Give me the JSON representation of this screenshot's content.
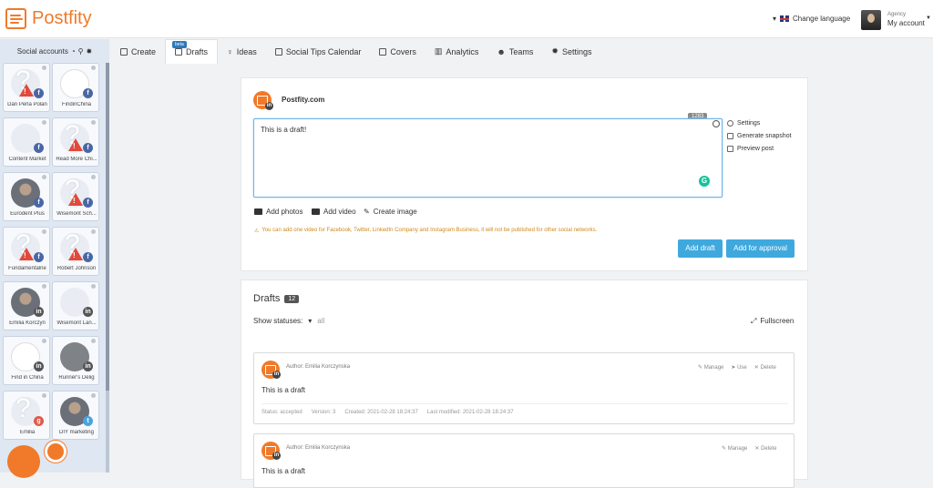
{
  "app": {
    "brand": "Postfity",
    "brand_color": "#f07a2a"
  },
  "topbar": {
    "change_language": "Change language",
    "account_role": "Agency",
    "account_label": "My account"
  },
  "sidebar": {
    "title": "Social accounts",
    "accounts": [
      {
        "name": "Dan Perla Polan",
        "network": "fb",
        "avatar": "placeholder-warning"
      },
      {
        "name": "FindinChina",
        "network": "fb",
        "avatar": "panda"
      },
      {
        "name": "Content Market",
        "network": "fb",
        "avatar": "wisemont"
      },
      {
        "name": "Read More Chi...",
        "network": "fb",
        "avatar": "placeholder-warning"
      },
      {
        "name": "Eurodent Plus",
        "network": "fb",
        "avatar": "photo"
      },
      {
        "name": "Wisemont Sch...",
        "network": "fb",
        "avatar": "placeholder-warning"
      },
      {
        "name": "Fundamentalne",
        "network": "fb",
        "avatar": "placeholder-warning"
      },
      {
        "name": "Robert Johnson",
        "network": "fb",
        "avatar": "placeholder-warning"
      },
      {
        "name": "Emilia Korczyn",
        "network": "li",
        "avatar": "photo"
      },
      {
        "name": "Wisemont Lan...",
        "network": "li",
        "avatar": "wisemont"
      },
      {
        "name": "Find in China",
        "network": "li",
        "avatar": "panda"
      },
      {
        "name": "Runner's Delig",
        "network": "li",
        "avatar": "runner"
      },
      {
        "name": "Emilia",
        "network": "gp",
        "avatar": "placeholder"
      },
      {
        "name": "DIY marketing",
        "network": "tw",
        "avatar": "photo"
      }
    ]
  },
  "tabs": [
    {
      "label": "Create",
      "icon": "edit-icon",
      "badge": ""
    },
    {
      "label": "Drafts",
      "icon": "drafts-icon",
      "badge": "beta"
    },
    {
      "label": "Ideas",
      "icon": "lightbulb-icon",
      "badge": ""
    },
    {
      "label": "Social Tips Calendar",
      "icon": "calendar-icon",
      "badge": ""
    },
    {
      "label": "Covers",
      "icon": "image-icon",
      "badge": ""
    },
    {
      "label": "Analytics",
      "icon": "bar-chart-icon",
      "badge": ""
    },
    {
      "label": "Teams",
      "icon": "users-icon",
      "badge": ""
    },
    {
      "label": "Settings",
      "icon": "gears-icon",
      "badge": ""
    }
  ],
  "composer": {
    "account_name": "Postfity.com",
    "text": "This is a draft!",
    "char_count": "1283",
    "settings": "Settings",
    "snapshot": "Generate snapshot",
    "preview": "Preview post",
    "add_photos": "Add photos",
    "add_video": "Add video",
    "create_image": "Create image",
    "notice": "You can add one video for Facebook, Twitter, LinkedIn Company and Instagram Business, it will not be published for other social networks.",
    "add_draft": "Add draft",
    "add_approval": "Add for approval"
  },
  "drafts": {
    "title": "Drafts",
    "count": "12",
    "show_statuses": "Show statuses:",
    "status_filter": "all",
    "fullscreen": "Fullscreen",
    "items": [
      {
        "author": "Author: Emilia Korczynska",
        "body": "This is a draft",
        "manage": "Manage",
        "use": "Use",
        "delete": "Delete",
        "status": "Status: accepted",
        "version": "Version: 3",
        "created": "Created: 2021-02-28 18:24:37",
        "modified": "Last modified: 2021-02-28 18:24:37"
      },
      {
        "author": "Author: Emilia Korczynska",
        "body": "This is a draft",
        "manage": "Manage",
        "delete": "Delete"
      }
    ]
  }
}
